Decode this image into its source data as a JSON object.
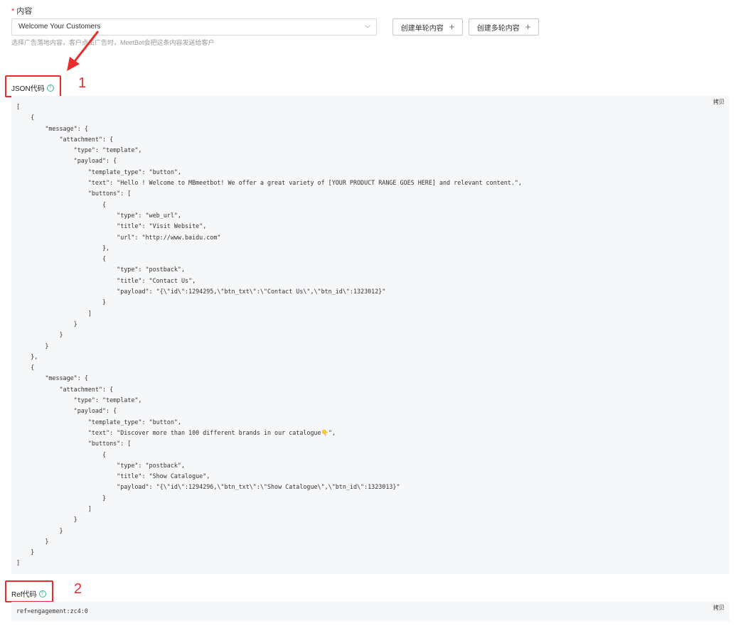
{
  "content_field": {
    "required_mark": "*",
    "label": "内容",
    "select_value": "Welcome Your Customers",
    "hint": "选择广告落地内容，客户点击广告时，MeetBot会把这条内容发送给客户"
  },
  "buttons": {
    "create_single": "创建单轮内容",
    "create_multi": "创建多轮内容"
  },
  "json_section": {
    "title": "JSON代码",
    "copy_label": "拷贝",
    "annotation_number": "1",
    "code": "[\n    {\n        \"message\": {\n            \"attachment\": {\n                \"type\": \"template\",\n                \"payload\": {\n                    \"template_type\": \"button\",\n                    \"text\": \"Hello ! Welcome to MBmeetbot! We offer a great variety of [YOUR PRODUCT RANGE GOES HERE] and relevant content.\",\n                    \"buttons\": [\n                        {\n                            \"type\": \"web_url\",\n                            \"title\": \"Visit Website\",\n                            \"url\": \"http://www.baidu.com\"\n                        },\n                        {\n                            \"type\": \"postback\",\n                            \"title\": \"Contact Us\",\n                            \"payload\": \"{\\\"id\\\":1294295,\\\"btn_txt\\\":\\\"Contact Us\\\",\\\"btn_id\\\":1323012}\"\n                        }\n                    ]\n                }\n            }\n        }\n    },\n    {\n        \"message\": {\n            \"attachment\": {\n                \"type\": \"template\",\n                \"payload\": {\n                    \"template_type\": \"button\",\n                    \"text\": \"Discover more than 100 different brands in our catalogue👇\",\n                    \"buttons\": [\n                        {\n                            \"type\": \"postback\",\n                            \"title\": \"Show Catalogue\",\n                            \"payload\": \"{\\\"id\\\":1294296,\\\"btn_txt\\\":\\\"Show Catalogue\\\",\\\"btn_id\\\":1323013}\"\n                        }\n                    ]\n                }\n            }\n        }\n    }\n]"
  },
  "ref_section": {
    "title": "Ref代码",
    "copy_label": "拷贝",
    "annotation_number": "2",
    "code": "ref=engagement:zc4:0"
  },
  "icons": {
    "select_arrow": "chevron-down-icon",
    "help": "question-circle-icon",
    "plus": "plus-icon",
    "annotation_arrow": "red-arrow"
  },
  "colors": {
    "required": "#f5222d",
    "annotation": "#ee2b2b",
    "help_icon": "#3ab39a",
    "code_bg": "#f6f7f8"
  }
}
